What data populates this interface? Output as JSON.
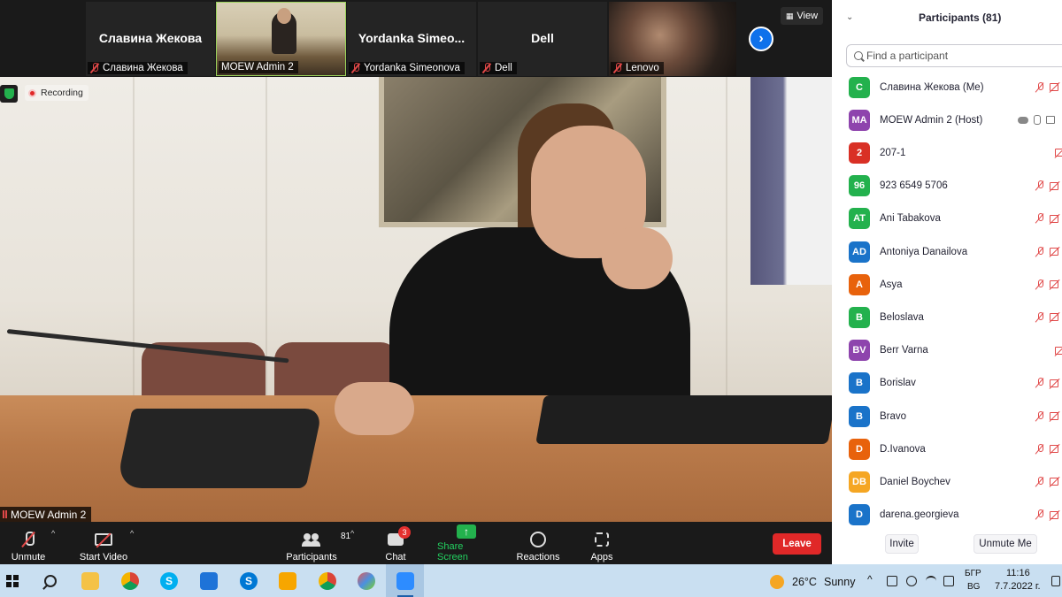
{
  "thumbnails": [
    {
      "name": "Славина Жекова",
      "label": "Славина Жекова"
    },
    {
      "name": "",
      "label": "MOEW Admin 2"
    },
    {
      "name": "Yordanka  Simeo...",
      "label": "Yordanka Simeonova"
    },
    {
      "name": "Dell",
      "label": "Dell"
    },
    {
      "name": "",
      "label": "Lenovo"
    }
  ],
  "view_label": "View",
  "recording_label": "Recording",
  "speaker_label": "MOEW Admin 2",
  "toolbar": {
    "unmute": "Unmute",
    "start_video": "Start Video",
    "participants_count": "81",
    "participants": "Participants",
    "chat": "Chat",
    "chat_badge": "3",
    "share_screen": "Share Screen",
    "reactions": "Reactions",
    "apps": "Apps",
    "leave": "Leave"
  },
  "panel": {
    "title": "Participants (81)",
    "search_placeholder": "Find a participant",
    "invite": "Invite",
    "unmute_me": "Unmute Me",
    "participants": [
      {
        "initials": "C",
        "name": "Славина Жекова (Me)",
        "color": "#23b14d"
      },
      {
        "initials": "MA",
        "name": "MOEW Admin 2 (Host)",
        "color": "#8e44ad"
      },
      {
        "initials": "2",
        "name": "207-1",
        "color": "#d93025"
      },
      {
        "initials": "96",
        "name": "923 6549 5706",
        "color": "#23b14d"
      },
      {
        "initials": "AT",
        "name": "Ani Tabakova",
        "color": "#23b14d"
      },
      {
        "initials": "AD",
        "name": "Antoniya Danailova",
        "color": "#1a73c9"
      },
      {
        "initials": "A",
        "name": "Asya",
        "color": "#e8620c"
      },
      {
        "initials": "B",
        "name": "Beloslava",
        "color": "#23b14d"
      },
      {
        "initials": "BV",
        "name": "Berr Varna",
        "color": "#8e44ad"
      },
      {
        "initials": "B",
        "name": "Borislav",
        "color": "#1a73c9"
      },
      {
        "initials": "B",
        "name": "Bravo",
        "color": "#1a73c9"
      },
      {
        "initials": "D",
        "name": "D.Ivanova",
        "color": "#e8620c"
      },
      {
        "initials": "DB",
        "name": "Daniel Boychev",
        "color": "#f5a623"
      },
      {
        "initials": "D",
        "name": "darena.georgieva",
        "color": "#1a73c9"
      }
    ]
  },
  "taskbar": {
    "temperature": "26°C",
    "weather": "Sunny",
    "lang_top": "БГР",
    "lang_bottom": "BG",
    "time": "11:16",
    "date": "7.7.2022 г."
  }
}
